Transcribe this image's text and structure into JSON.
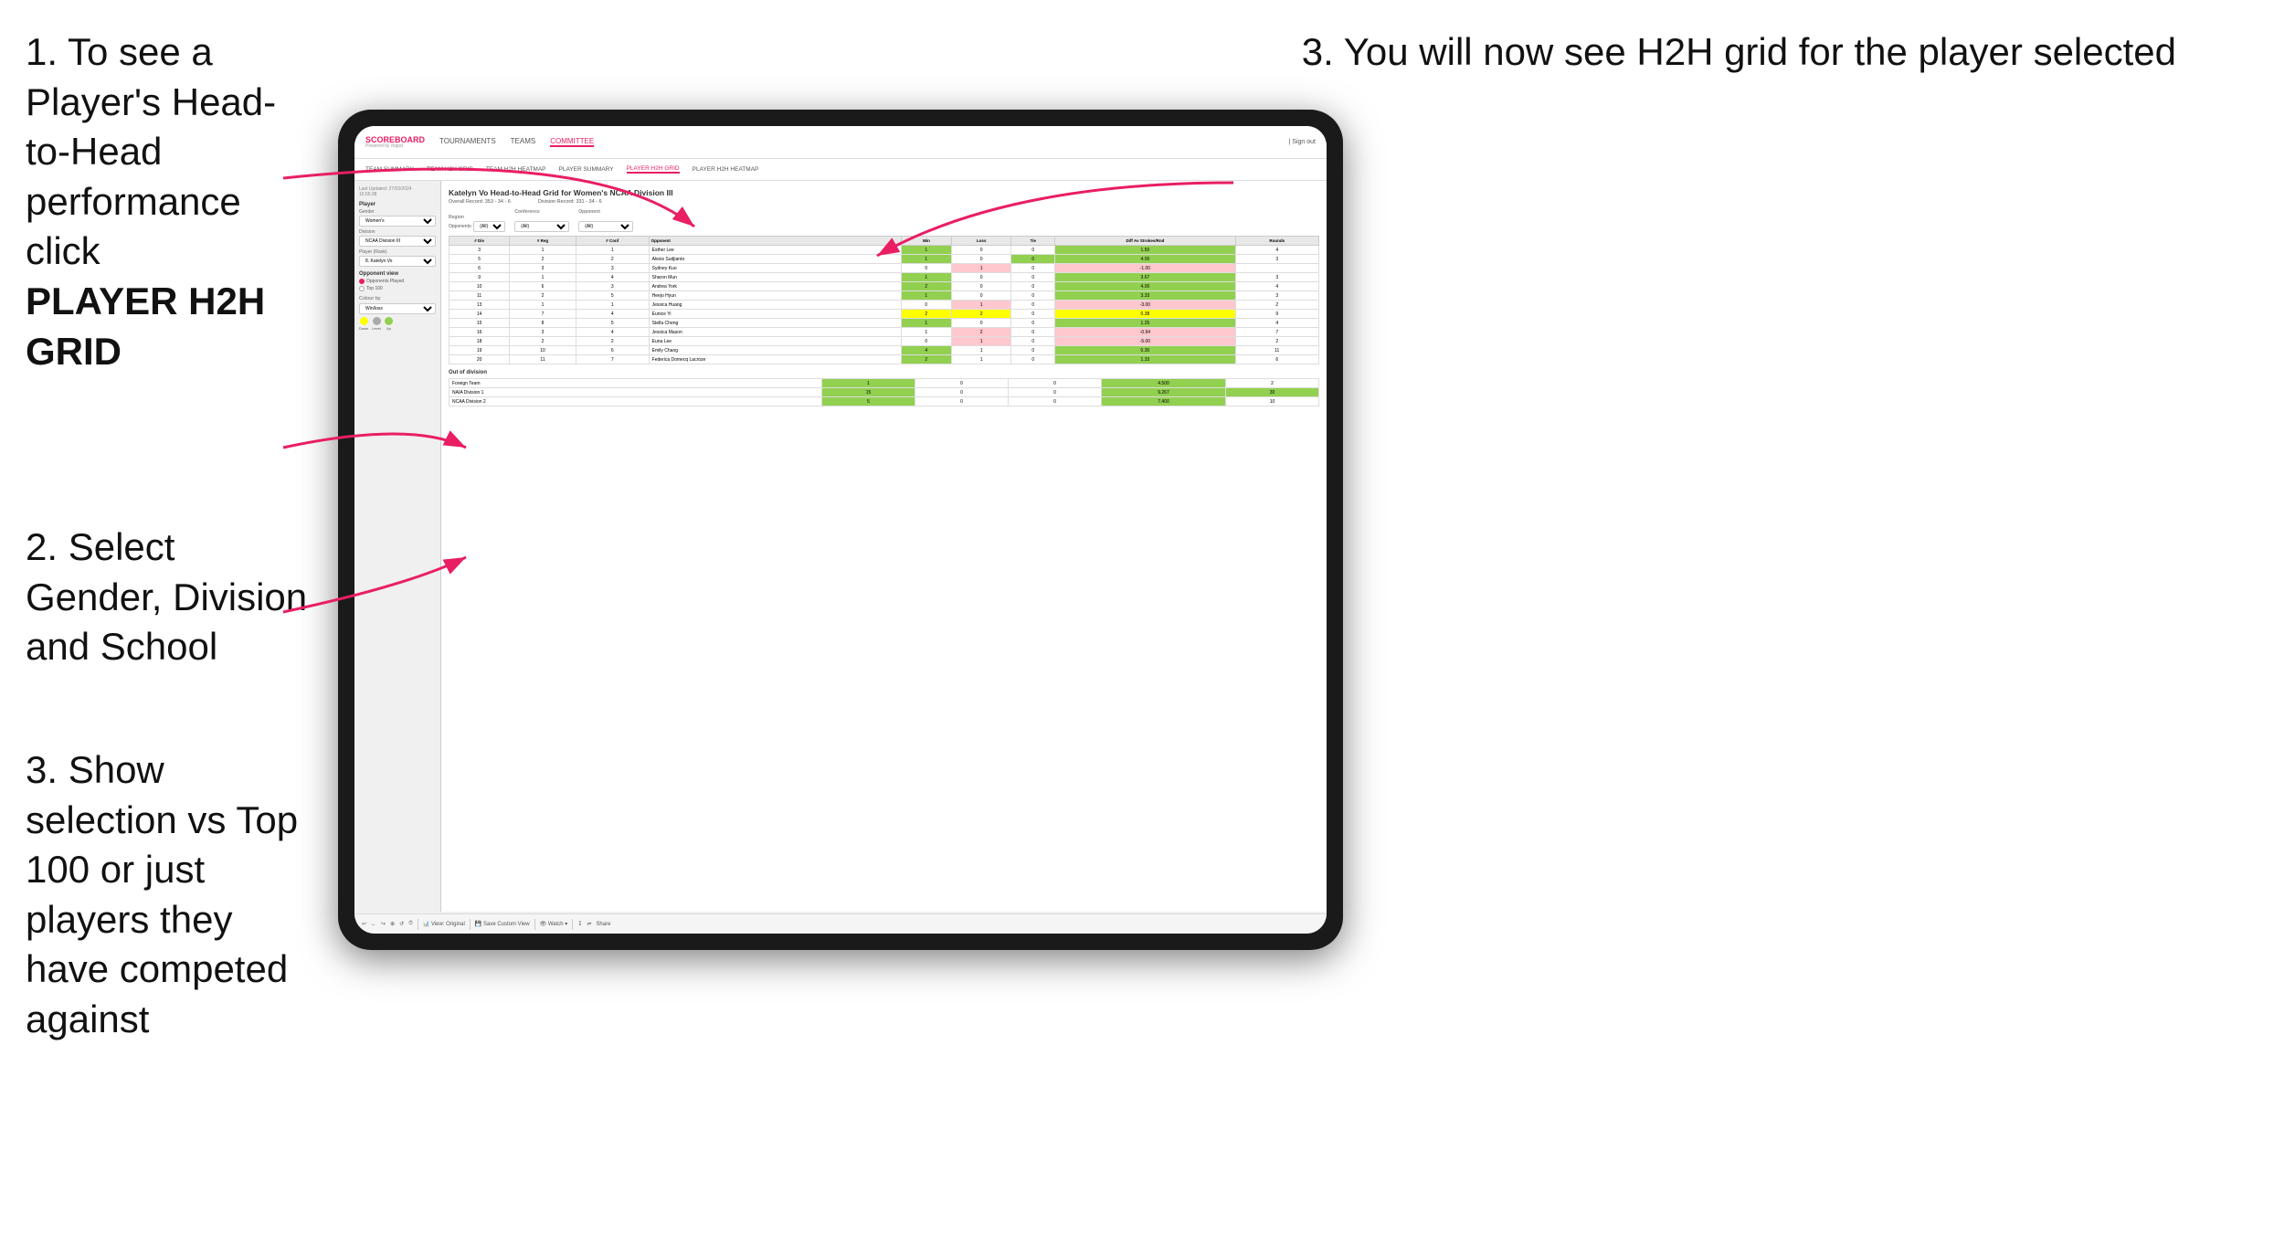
{
  "page": {
    "instructions": [
      {
        "id": "instr1",
        "text": "1. To see a Player's Head-to-Head performance click ",
        "bold": "PLAYER H2H GRID"
      },
      {
        "id": "instr2",
        "text": "2. Select Gender, Division and School",
        "bold": null
      },
      {
        "id": "instr3",
        "text": "3. Show selection vs Top 100 or just players they have competed against",
        "bold": null
      }
    ],
    "top_right_instruction": "3. You will now see H2H grid\nfor the player selected",
    "app": {
      "logo": "SCOREBOARD",
      "powered_by": "Powered by clippd",
      "nav_items": [
        "TOURNAMENTS",
        "TEAMS",
        "COMMITTEE"
      ],
      "active_nav": "COMMITTEE",
      "sign_out": "| Sign out",
      "sub_nav": [
        "TEAM SUMMARY",
        "TEAM H2H GRID",
        "TEAM H2H HEATMAP",
        "PLAYER SUMMARY",
        "PLAYER H2H GRID",
        "PLAYER H2H HEATMAP"
      ],
      "active_sub_nav": "PLAYER H2H GRID"
    },
    "left_panel": {
      "timestamp": "Last Updated: 27/03/2024\n16:55:38",
      "player_section": {
        "label": "Player",
        "gender_label": "Gender",
        "gender_value": "Women's",
        "division_label": "Division",
        "division_value": "NCAA Division III",
        "player_rank_label": "Player (Rank)",
        "player_rank_value": "8. Katelyn Vo"
      },
      "opponent_view": {
        "label": "Opponent view",
        "options": [
          "Opponents Played",
          "Top 100"
        ],
        "selected": "Opponents Played"
      },
      "colour_by": {
        "label": "Colour by",
        "value": "Win/loss",
        "legend": [
          {
            "color": "#ffff00",
            "label": "Down"
          },
          {
            "color": "#cccccc",
            "label": "Level"
          },
          {
            "color": "#92d050",
            "label": "Up"
          }
        ]
      }
    },
    "h2h": {
      "title": "Katelyn Vo Head-to-Head Grid for Women's NCAA Division III",
      "overall_record": "Overall Record: 353 - 34 - 6",
      "division_record": "Division Record: 331 - 34 - 6",
      "filters": {
        "region_label": "Region",
        "opponents_label": "Opponents:",
        "opponents_value": "(All)",
        "conference_label": "Conference",
        "conference_value": "(All)",
        "opponent_label": "Opponent",
        "opponent_value": "(All)"
      },
      "table_headers": [
        "# Div",
        "# Reg",
        "# Conf",
        "Opponent",
        "Win",
        "Loss",
        "Tie",
        "Diff Av Strokes/Rnd",
        "Rounds"
      ],
      "rows": [
        {
          "div": 3,
          "reg": 1,
          "conf": 1,
          "opponent": "Esther Lee",
          "win": 1,
          "loss": 0,
          "tie": 0,
          "diff": 1.5,
          "rounds": 4,
          "win_color": "green"
        },
        {
          "div": 5,
          "reg": 2,
          "conf": 2,
          "opponent": "Alexis Sudjianto",
          "win": 1,
          "loss": 0,
          "tie": 0,
          "diff": 4.0,
          "rounds": 3,
          "win_color": "green"
        },
        {
          "div": 6,
          "reg": 3,
          "conf": 3,
          "opponent": "Sydney Kuo",
          "win": 0,
          "loss": 1,
          "tie": 0,
          "diff": -1.0,
          "rounds": null,
          "win_color": "none"
        },
        {
          "div": 9,
          "reg": 1,
          "conf": 4,
          "opponent": "Sharon Mun",
          "win": 1,
          "loss": 0,
          "tie": 0,
          "diff": 3.67,
          "rounds": 3,
          "win_color": "green"
        },
        {
          "div": 10,
          "reg": 6,
          "conf": 3,
          "opponent": "Andrea York",
          "win": 2,
          "loss": 0,
          "tie": 0,
          "diff": 4.0,
          "rounds": 4,
          "win_color": "green"
        },
        {
          "div": 11,
          "reg": 2,
          "conf": 5,
          "opponent": "Heejo Hyun",
          "win": 1,
          "loss": 0,
          "tie": 0,
          "diff": 3.33,
          "rounds": 3,
          "win_color": "green"
        },
        {
          "div": 13,
          "reg": 1,
          "conf": 1,
          "opponent": "Jessica Huang",
          "win": 0,
          "loss": 1,
          "tie": 0,
          "diff": -3.0,
          "rounds": 2,
          "win_color": "none"
        },
        {
          "div": 14,
          "reg": 7,
          "conf": 4,
          "opponent": "Eunice Yi",
          "win": 2,
          "loss": 2,
          "tie": 0,
          "diff": 0.38,
          "rounds": 9,
          "win_color": "yellow"
        },
        {
          "div": 15,
          "reg": 8,
          "conf": 5,
          "opponent": "Stella Cheng",
          "win": 1,
          "loss": 0,
          "tie": 0,
          "diff": 1.25,
          "rounds": 4,
          "win_color": "green"
        },
        {
          "div": 16,
          "reg": 3,
          "conf": 4,
          "opponent": "Jessica Mason",
          "win": 1,
          "loss": 2,
          "tie": 0,
          "diff": -0.94,
          "rounds": 7,
          "win_color": "none"
        },
        {
          "div": 18,
          "reg": 2,
          "conf": 2,
          "opponent": "Euna Lee",
          "win": 0,
          "loss": 1,
          "tie": 0,
          "diff": -5.0,
          "rounds": 2,
          "win_color": "none"
        },
        {
          "div": 19,
          "reg": 10,
          "conf": 6,
          "opponent": "Emily Chang",
          "win": 4,
          "loss": 1,
          "tie": 0,
          "diff": 0.3,
          "rounds": 11,
          "win_color": "green"
        },
        {
          "div": 20,
          "reg": 11,
          "conf": 7,
          "opponent": "Federica Domecq Lacroze",
          "win": 2,
          "loss": 1,
          "tie": 0,
          "diff": 1.33,
          "rounds": 6,
          "win_color": "green"
        }
      ],
      "out_of_division": {
        "label": "Out of division",
        "rows": [
          {
            "team": "Foreign Team",
            "win": 1,
            "loss": 0,
            "tie": 0,
            "diff": 4.5,
            "rounds": 2
          },
          {
            "team": "NAIA Division 1",
            "win": 15,
            "loss": 0,
            "tie": 0,
            "diff": 9.267,
            "rounds": 30
          },
          {
            "team": "NCAA Division 2",
            "win": 5,
            "loss": 0,
            "tie": 0,
            "diff": 7.4,
            "rounds": 10
          }
        ]
      }
    },
    "toolbar": {
      "items": [
        "↩",
        "←",
        "↪",
        "⊕",
        "↙",
        "·",
        "↺",
        "⏱",
        "View: Original",
        "Save Custom View",
        "👁 Watch ▾",
        "↧",
        "⇌",
        "Share"
      ]
    }
  }
}
